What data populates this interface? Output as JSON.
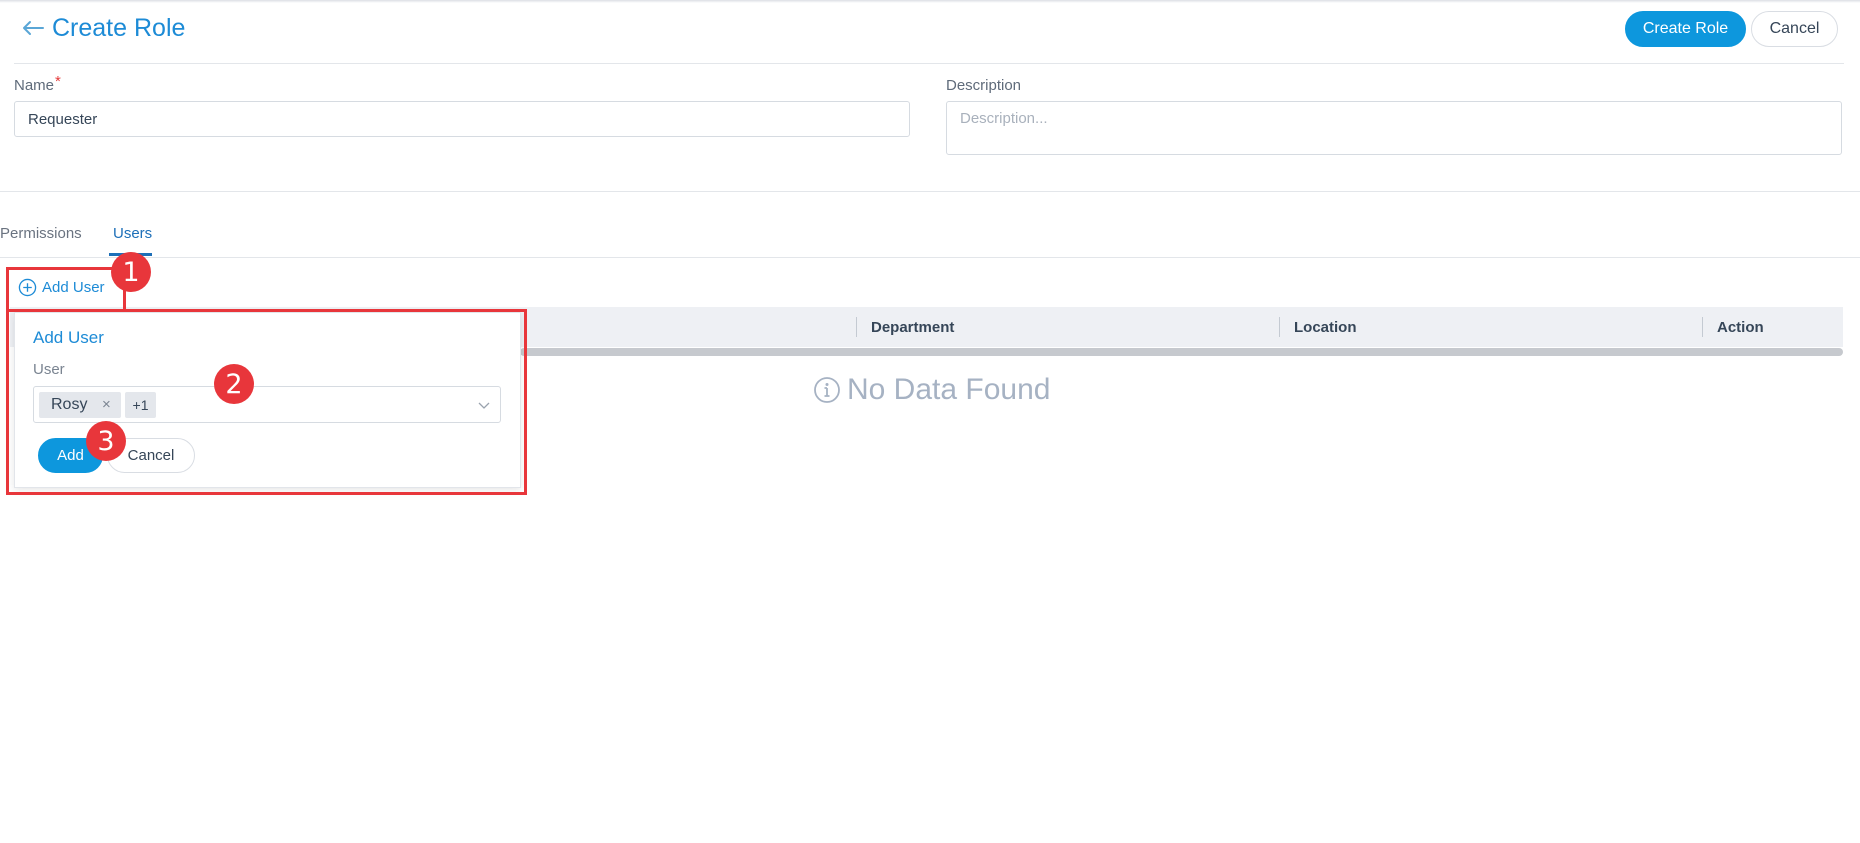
{
  "header": {
    "title": "Create Role",
    "create_role_label": "Create Role",
    "cancel_label": "Cancel"
  },
  "form": {
    "name_label": "Name",
    "name_required_marker": "*",
    "name_value": "Requester",
    "description_label": "Description",
    "description_placeholder": "Description..."
  },
  "tabs": [
    {
      "label": "Permissions",
      "active": false
    },
    {
      "label": "Users",
      "active": true
    }
  ],
  "users_tab": {
    "add_user_label": "Add User",
    "columns": [
      "Department",
      "Location",
      "Action"
    ],
    "empty_text": "No Data Found"
  },
  "popover": {
    "title": "Add User",
    "user_label": "User",
    "selected_chips": [
      "Rosy"
    ],
    "more_count": "+1",
    "add_label": "Add",
    "cancel_label": "Cancel"
  },
  "annotations": [
    "1",
    "2",
    "3"
  ],
  "colors": {
    "accent": "#0d97dd",
    "link": "#1d8bd6",
    "highlight": "#e8363b"
  }
}
